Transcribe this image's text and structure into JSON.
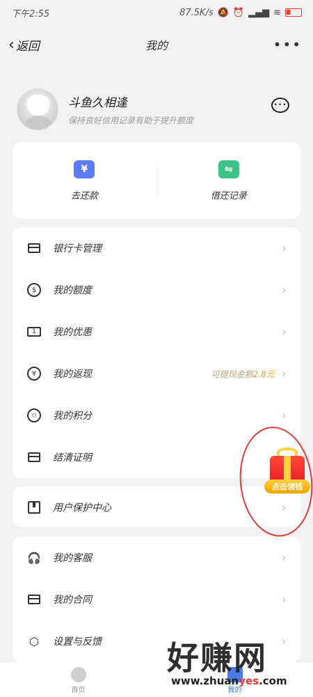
{
  "status": {
    "time": "下午2:55",
    "network_speed": "87.5K/s",
    "icons": [
      "mute-icon",
      "alarm-icon",
      "hd-icon",
      "signal-icon",
      "wifi-icon",
      "battery-icon"
    ],
    "battery_color": "#e53935"
  },
  "nav": {
    "back_label": "返回",
    "title": "我的",
    "more": "•••"
  },
  "profile": {
    "name": "斗鱼久相逢",
    "subtitle": "保持良好信用记录有助于提升额度"
  },
  "quick_actions": [
    {
      "label": "去还款",
      "icon": "yuan-icon",
      "glyph": "¥",
      "color": "#5b7cf2"
    },
    {
      "label": "借还记录",
      "icon": "exchange-icon",
      "glyph": "⇋",
      "color": "#3ec48a"
    }
  ],
  "menu1": [
    {
      "label": "银行卡管理",
      "icon": "bank-card-icon"
    },
    {
      "label": "我的额度",
      "icon": "money-bag-icon"
    },
    {
      "label": "我的优惠",
      "icon": "coupon-icon"
    },
    {
      "label": "我的返现",
      "icon": "cashback-icon",
      "extra_text": "可提现金额",
      "extra_amount": "2.8元"
    },
    {
      "label": "我的积分",
      "icon": "points-icon"
    },
    {
      "label": "结清证明",
      "icon": "printer-icon"
    }
  ],
  "menu2": [
    {
      "label": "用户保护中心",
      "icon": "shield-icon"
    }
  ],
  "menu3": [
    {
      "label": "我的客服",
      "icon": "headset-icon"
    },
    {
      "label": "我的合同",
      "icon": "contract-icon"
    },
    {
      "label": "设置与反馈",
      "icon": "settings-icon"
    }
  ],
  "gift": {
    "label": "点击领钱"
  },
  "tabs": [
    {
      "label": "首页",
      "active": false
    },
    {
      "label": "我的",
      "active": true
    }
  ],
  "watermark": {
    "big": "好赚网",
    "small_prefix": "www.zhuan",
    "small_highlight": "yes",
    "small_suffix": ".com"
  },
  "colors": {
    "accent": "#4a7be8",
    "gold": "#f0a23c"
  }
}
